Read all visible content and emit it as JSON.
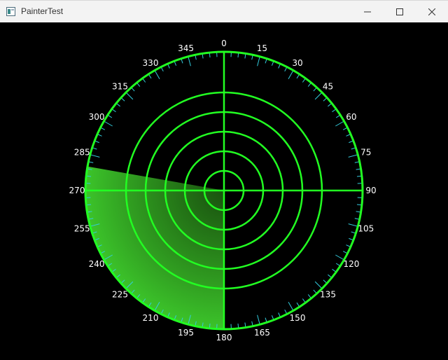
{
  "window": {
    "title": "PainterTest",
    "icon": "app-window-icon",
    "controls": [
      "minimize-icon",
      "maximize-icon",
      "close-icon"
    ]
  },
  "radar": {
    "angle_labels": [
      "0",
      "15",
      "30",
      "45",
      "60",
      "75",
      "90",
      "105",
      "120",
      "135",
      "150",
      "165",
      "180",
      "195",
      "210",
      "225",
      "240",
      "255",
      "270",
      "285",
      "300",
      "315",
      "330",
      "345"
    ],
    "ring_count": 6,
    "sweep": {
      "from_deg": 180,
      "to_deg": 280
    },
    "colors": {
      "background": "#000000",
      "rings": "#22ff22",
      "ticks": "#33ccdd",
      "labels": "#ffffff",
      "sweep": "#33cc22"
    }
  }
}
